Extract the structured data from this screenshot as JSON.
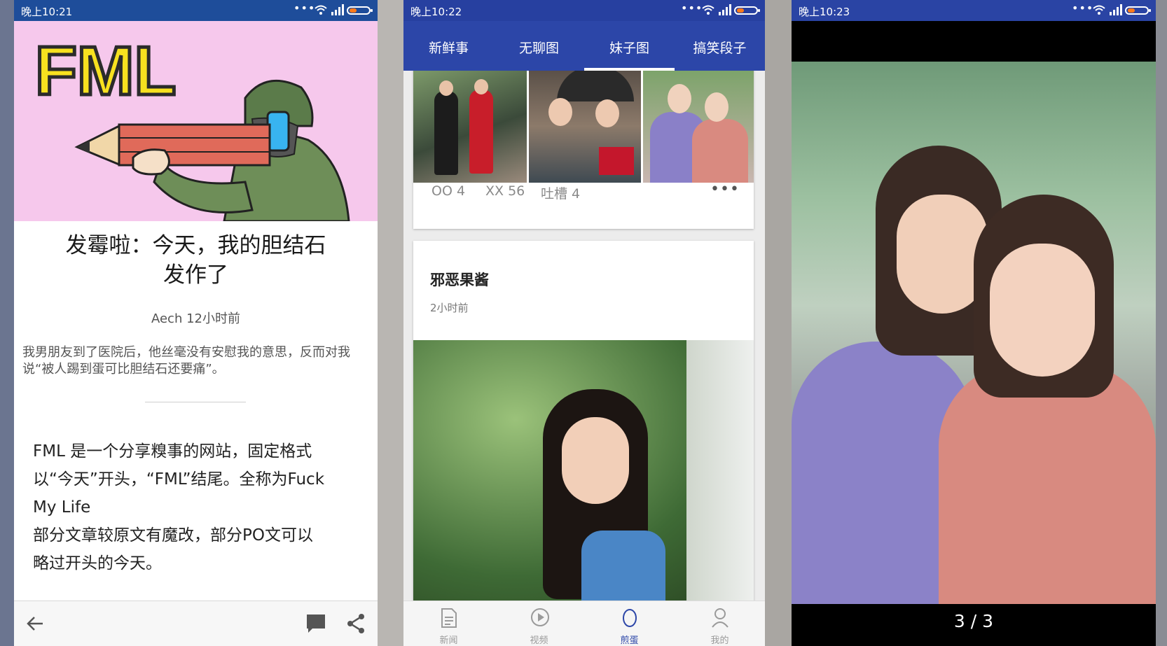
{
  "phones": [
    {
      "status": {
        "time": "晚上10:21"
      },
      "article": {
        "image_text": "FML",
        "title_line1": "发霉啦：今天，我的胆结石",
        "title_line2": "发作了",
        "meta": "Aech 12小时前",
        "body": "我男朋友到了医院后，他丝毫没有安慰我的意思，反而对我说“被人踢到蛋可比胆结石还要痛”。",
        "intro": "FML 是一个分享糗事的网站，固定格式\n以“今天”开头，“FML”结尾。全称为Fuck\nMy Life\n部分文章较原文有魔改，部分PO文可以\n略过开头的今天。"
      },
      "toolbar_icons": [
        "back-arrow-icon",
        "comment-icon",
        "share-icon"
      ]
    },
    {
      "status": {
        "time": "晚上10:22"
      },
      "tabs": [
        {
          "label": "新鲜事"
        },
        {
          "label": "无聊图"
        },
        {
          "label": "妹子图",
          "active": true
        },
        {
          "label": "搞笑段子"
        }
      ],
      "card1": {
        "oo": "OO 4",
        "xx": "XX 56",
        "comments": "吐槽 4",
        "more": "•••"
      },
      "card2": {
        "author": "邪恶果酱",
        "time": "2小时前"
      },
      "bottom_nav": [
        {
          "label": "新闻",
          "icon": "news-icon"
        },
        {
          "label": "视频",
          "icon": "play-icon"
        },
        {
          "label": "煎蛋",
          "icon": "egg-icon",
          "active": true
        },
        {
          "label": "我的",
          "icon": "profile-icon"
        }
      ]
    },
    {
      "status": {
        "time": "晚上10:23"
      },
      "viewer": {
        "counter": "3 / 3"
      }
    }
  ],
  "colors": {
    "primary_blue": "#2c46a8",
    "status_blue": "#1e4d9a",
    "fml_pink": "#f6c8ec",
    "battery_orange": "#ff7a1a"
  }
}
